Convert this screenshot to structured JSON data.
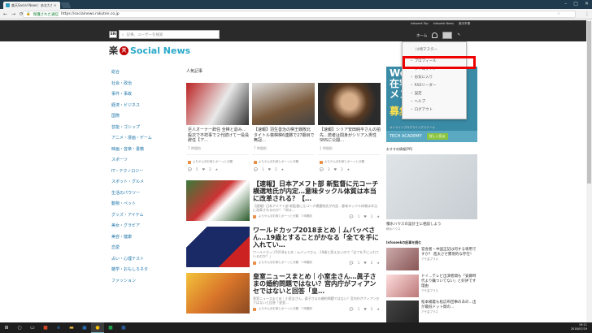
{
  "browser": {
    "tab_title": "楽天Social News：あなたが…",
    "secure_label": "保護された通信",
    "url": "https://socialnews.rakuten.co.jp"
  },
  "site": {
    "top_links": [
      "Infoseek Top",
      "Infoseek News",
      "楽天市場"
    ],
    "search_placeholder": "記事、ユーザーを検索",
    "home_label": "ホーム",
    "brand_rakuten": "楽",
    "brand_ten": "天",
    "brand_name": "Social News"
  },
  "dropdown": {
    "user": "川崎マスター",
    "items": [
      "プロフィール",
      "タイムライン",
      "お気に入り",
      "RSSリーダー",
      "設定",
      "ヘルプ",
      "ログアウト"
    ]
  },
  "categories": [
    "総合",
    "社会・政治",
    "事件・事故",
    "経済・ビジネス",
    "国際",
    "芸能・ゴシップ",
    "アニメ・漫画・ゲーム",
    "映画・音楽・書籍",
    "スポーツ",
    "IT・テクノロジー",
    "スポット・グルメ",
    "生活のパウツー",
    "動物・ペット",
    "グッズ・アイテム",
    "美女・グラビア",
    "美容・健康",
    "恋愛",
    "占い・心理テスト",
    "雑学・おもしろネタ",
    "ファッション"
  ],
  "popular_title": "人気記事",
  "cards": [
    {
      "title": "巨人オーナー辞任 全棒と退み…殺次で不祥事で２代続けて一役員辞任【ア…",
      "time": "7 時間前",
      "source": "よもやん＠お家とボーっと分類",
      "comments": "5",
      "likes": "2"
    },
    {
      "title": "【速報】羽生善治の棋王戦敗北 タイトル喪棋棋6連勝で27期目で無冠…",
      "time": "7 時間前",
      "source": "よもやん＠お家とボーっと分類",
      "comments": "1",
      "likes": "2"
    },
    {
      "title": "【速報】シリア安田純平さんの拍先…若者は間身がシリア入男性SNSに公開…",
      "time": "1 時間前",
      "source": "よもやん＠お家とボーっと分類",
      "comments": "3",
      "likes": "2"
    }
  ],
  "rows": [
    {
      "title": "【速報】日本アメフト部 新監督に元コーチ横選地氏が内定…意味タックル体質は本当に改革される？【…",
      "sub": "【速報】日本アメフト部 新監督に元コーチ横選地氏が内定…意味タックル体質は本当に改革されるのか？「知る…",
      "source": "よもやん＠お家とボーっと分類",
      "time": "7 時間前",
      "comments": "1",
      "likes": "2"
    },
    {
      "title": "ワールドカップ2018まとめ｜ムバッペさん…19歳とすることがかなる「全てを手に入れてい…",
      "sub": "ワールドカップ2018まとめ｜ムバッペさん…19歳と思えないので「全てを手に入れているのか？」",
      "source": "よもやん＠お家とボーっと分類",
      "time": "7 時間前",
      "comments": "1",
      "likes": "2"
    },
    {
      "title": "皇室ニュースまとめ｜小室圭さん…眞子さまの婚約問題ではない？宮内庁がフィアンセではないと回答「皇…",
      "sub": "皇室ニュースまとめ｜小室圭さん…眞子さまの婚約問題ではない？宮内庁がフィアンセではないと回答「皇室…",
      "source": "よもやん＠お家とボーっと分類",
      "time": "7 時間前",
      "comments": "1",
      "likes": "2"
    }
  ],
  "ad": {
    "line1": "Word",
    "line2": "在宅",
    "line3": "メン",
    "line4": "募集",
    "sub": "オンラインプログラミングスクール",
    "brand": "TECH ACADEMY",
    "cta": "詳しく見る"
  },
  "side": {
    "recommend": "おすすめ情報[PR]",
    "img_caption": "積水ハウスの設計士に相談しよう",
    "img_source": "積水ハウス",
    "infoseek_title": "Infoseekの記事を読む",
    "items": [
      {
        "text": "官会者・中国正記は何する専用ですか？ 進太させ實現的な存在！",
        "source": "アサ芸プラス"
      },
      {
        "text": "ドイ…テレビ出演者間も「安藤時代より臓ついてない」と好評です理由",
        "source": "アサ芸プラス"
      },
      {
        "text": "松本補着も松広布団事のあの…出が最低ドット間の…",
        "source": "アサ芸プラス"
      }
    ]
  },
  "taskbar": {
    "time": "19:11",
    "date": "2018/07/19"
  }
}
